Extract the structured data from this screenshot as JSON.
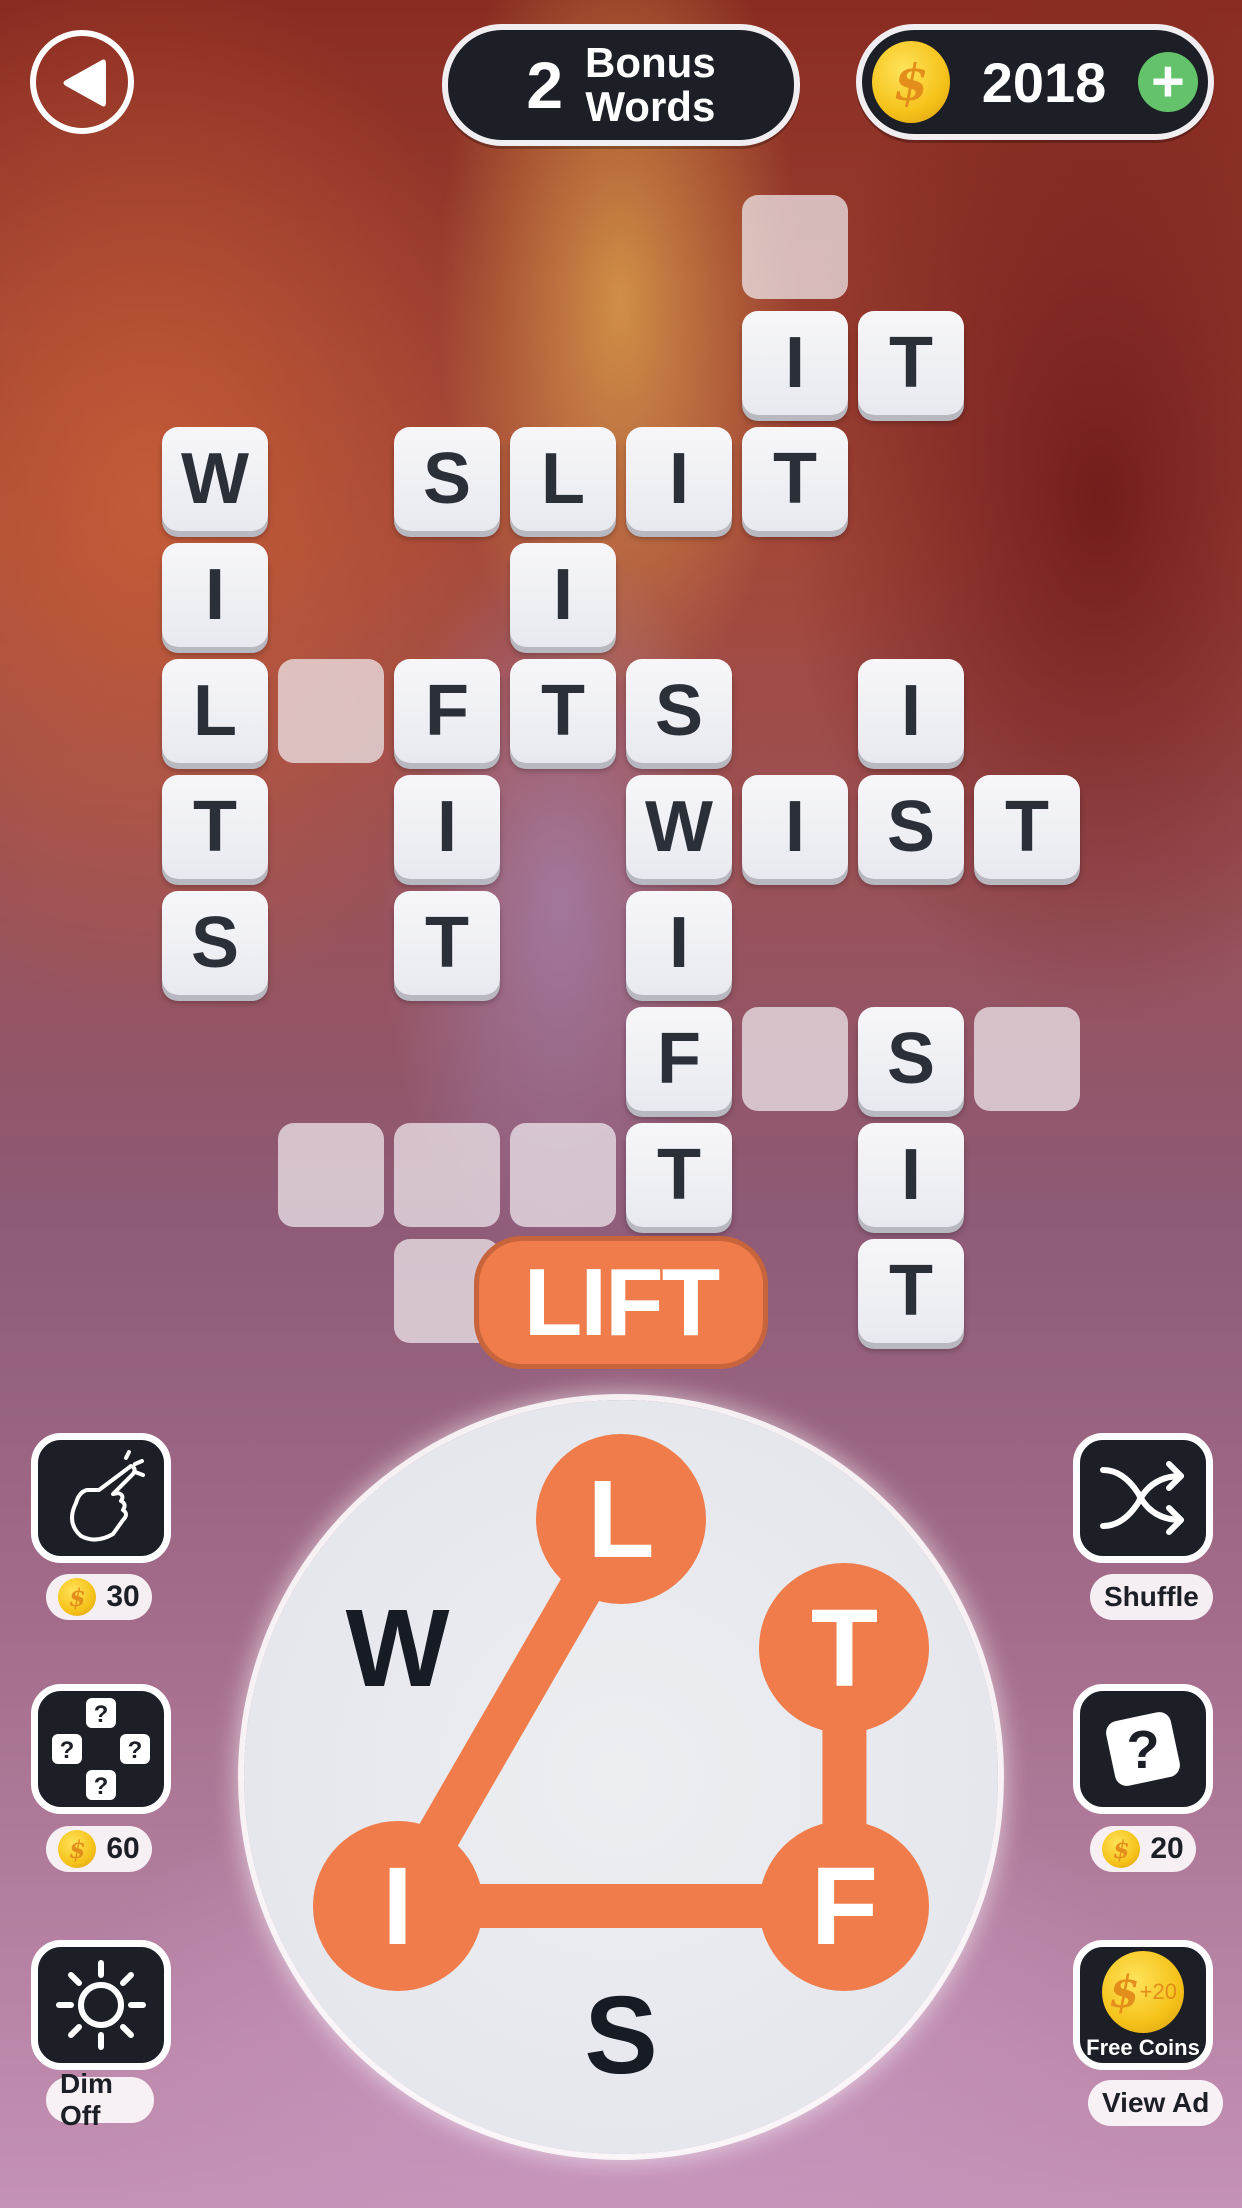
{
  "header": {
    "back_icon": "back-arrow-icon",
    "bonus_count": "2",
    "bonus_label_line1": "Bonus",
    "bonus_label_line2": "Words",
    "coin_icon": "coin-icon",
    "coin_symbol": "$",
    "coins": "2018",
    "add_coins_icon": "plus-icon",
    "add_coins_symbol": "+"
  },
  "colors": {
    "accent": "#ef7c4a",
    "dark_button": "#1c1f26",
    "tile": "#f3f3f7",
    "tile_text": "#2b2f38",
    "plus_green": "#63c26a",
    "coin_gold": "#f5c21a"
  },
  "grid": {
    "tiles": [
      {
        "row": 0,
        "col": 5,
        "letter": ""
      },
      {
        "row": 1,
        "col": 5,
        "letter": "I"
      },
      {
        "row": 1,
        "col": 6,
        "letter": "T"
      },
      {
        "row": 2,
        "col": 0,
        "letter": "W"
      },
      {
        "row": 2,
        "col": 2,
        "letter": "S"
      },
      {
        "row": 2,
        "col": 3,
        "letter": "L"
      },
      {
        "row": 2,
        "col": 4,
        "letter": "I"
      },
      {
        "row": 2,
        "col": 5,
        "letter": "T"
      },
      {
        "row": 3,
        "col": 0,
        "letter": "I"
      },
      {
        "row": 3,
        "col": 3,
        "letter": "I"
      },
      {
        "row": 4,
        "col": 0,
        "letter": "L"
      },
      {
        "row": 4,
        "col": 1,
        "letter": ""
      },
      {
        "row": 4,
        "col": 2,
        "letter": "F"
      },
      {
        "row": 4,
        "col": 3,
        "letter": "T"
      },
      {
        "row": 4,
        "col": 4,
        "letter": "S"
      },
      {
        "row": 4,
        "col": 6,
        "letter": "I"
      },
      {
        "row": 5,
        "col": 0,
        "letter": "T"
      },
      {
        "row": 5,
        "col": 2,
        "letter": "I"
      },
      {
        "row": 5,
        "col": 4,
        "letter": "W"
      },
      {
        "row": 5,
        "col": 5,
        "letter": "I"
      },
      {
        "row": 5,
        "col": 6,
        "letter": "S"
      },
      {
        "row": 5,
        "col": 7,
        "letter": "T"
      },
      {
        "row": 6,
        "col": 0,
        "letter": "S"
      },
      {
        "row": 6,
        "col": 2,
        "letter": "T"
      },
      {
        "row": 6,
        "col": 4,
        "letter": "I"
      },
      {
        "row": 7,
        "col": 4,
        "letter": "F"
      },
      {
        "row": 7,
        "col": 5,
        "letter": ""
      },
      {
        "row": 7,
        "col": 6,
        "letter": "S"
      },
      {
        "row": 7,
        "col": 7,
        "letter": ""
      },
      {
        "row": 8,
        "col": 1,
        "letter": ""
      },
      {
        "row": 8,
        "col": 2,
        "letter": ""
      },
      {
        "row": 8,
        "col": 3,
        "letter": ""
      },
      {
        "row": 8,
        "col": 4,
        "letter": "T"
      },
      {
        "row": 8,
        "col": 6,
        "letter": "I"
      },
      {
        "row": 9,
        "col": 2,
        "letter": ""
      },
      {
        "row": 9,
        "col": 6,
        "letter": "T"
      }
    ]
  },
  "current_word": "LIFT",
  "wheel": {
    "letters": [
      {
        "letter": "L",
        "selected": true
      },
      {
        "letter": "T",
        "selected": true
      },
      {
        "letter": "F",
        "selected": true
      },
      {
        "letter": "S",
        "selected": false
      },
      {
        "letter": "I",
        "selected": true
      },
      {
        "letter": "W",
        "selected": false
      }
    ],
    "path": [
      "L",
      "I",
      "F",
      "T"
    ]
  },
  "left_controls": [
    {
      "name": "hint-finger",
      "icon": "finger-tap-icon",
      "price": "30"
    },
    {
      "name": "reveal-random",
      "icon": "random-reveal-icon",
      "price": "60"
    },
    {
      "name": "dim",
      "icon": "sun-icon",
      "label": "Dim Off"
    }
  ],
  "right_controls": [
    {
      "name": "shuffle",
      "icon": "shuffle-icon",
      "label": "Shuffle"
    },
    {
      "name": "hint-letter",
      "icon": "question-icon",
      "price": "20"
    },
    {
      "name": "free-coins",
      "icon": "free-coins-icon",
      "badge_text": "+20",
      "caption": "Free Coins",
      "label": "View Ad"
    }
  ]
}
